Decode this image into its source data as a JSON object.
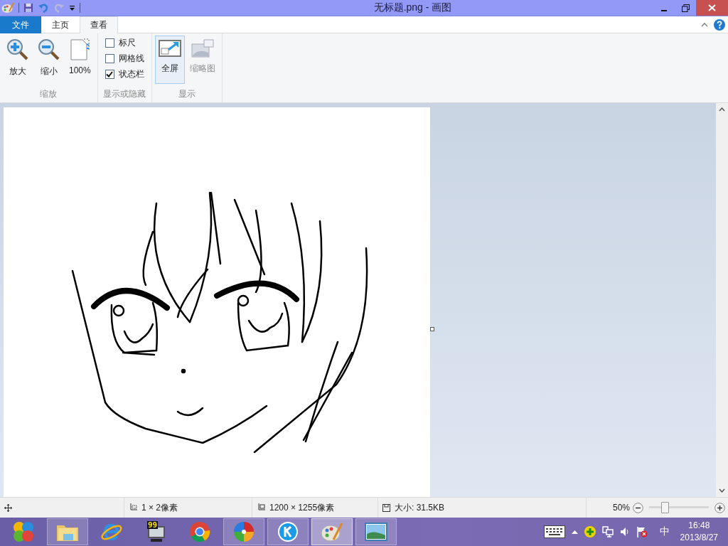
{
  "window": {
    "title": "无标题.png - 画图"
  },
  "tabs": [
    {
      "label": "文件",
      "kind": "file",
      "selected": false
    },
    {
      "label": "主页",
      "kind": "normal",
      "selected": false
    },
    {
      "label": "查看",
      "kind": "normal",
      "selected": true
    }
  ],
  "ribbon": {
    "groups": [
      {
        "title": "缩放",
        "items": [
          {
            "kind": "zoom-in",
            "label": "放大"
          },
          {
            "kind": "zoom-out",
            "label": "缩小"
          },
          {
            "kind": "actual-size",
            "label": "100%"
          }
        ]
      },
      {
        "title": "显示或隐藏",
        "items": [
          {
            "kind": "checkbox",
            "label": "标尺",
            "checked": false
          },
          {
            "kind": "checkbox",
            "label": "网格线",
            "checked": false
          },
          {
            "kind": "checkbox",
            "label": "状态栏",
            "checked": true
          }
        ]
      },
      {
        "title": "显示",
        "items": [
          {
            "kind": "fullscreen",
            "label": "全屏",
            "highlighted": true,
            "disabled": false
          },
          {
            "kind": "thumbnail",
            "label": "缩略图",
            "highlighted": false,
            "disabled": true
          }
        ]
      }
    ]
  },
  "status_bar": {
    "selection": "1 × 2像素",
    "image_size": "1200 × 1255像素",
    "file_size": "大小: 31.5KB",
    "zoom": "50%",
    "zoom_slider": {
      "level": 0.26
    }
  },
  "taskbar": {
    "apps": [
      {
        "kind": "start-orb",
        "running": false,
        "selected": false
      },
      {
        "kind": "folder",
        "running": true,
        "selected": false
      },
      {
        "kind": "browser-e",
        "running": false,
        "selected": false
      },
      {
        "kind": "monitor",
        "running": false,
        "selected": false,
        "badge": "99"
      },
      {
        "kind": "chrome",
        "running": false,
        "selected": false
      },
      {
        "kind": "pinwheel",
        "running": true,
        "selected": false
      },
      {
        "kind": "k-circle",
        "running": true,
        "selected": false
      },
      {
        "kind": "paint",
        "running": true,
        "selected": true
      },
      {
        "kind": "photo",
        "running": true,
        "selected": false
      }
    ],
    "input_method": "中",
    "time": "16:48",
    "date": "2013/8/27"
  }
}
